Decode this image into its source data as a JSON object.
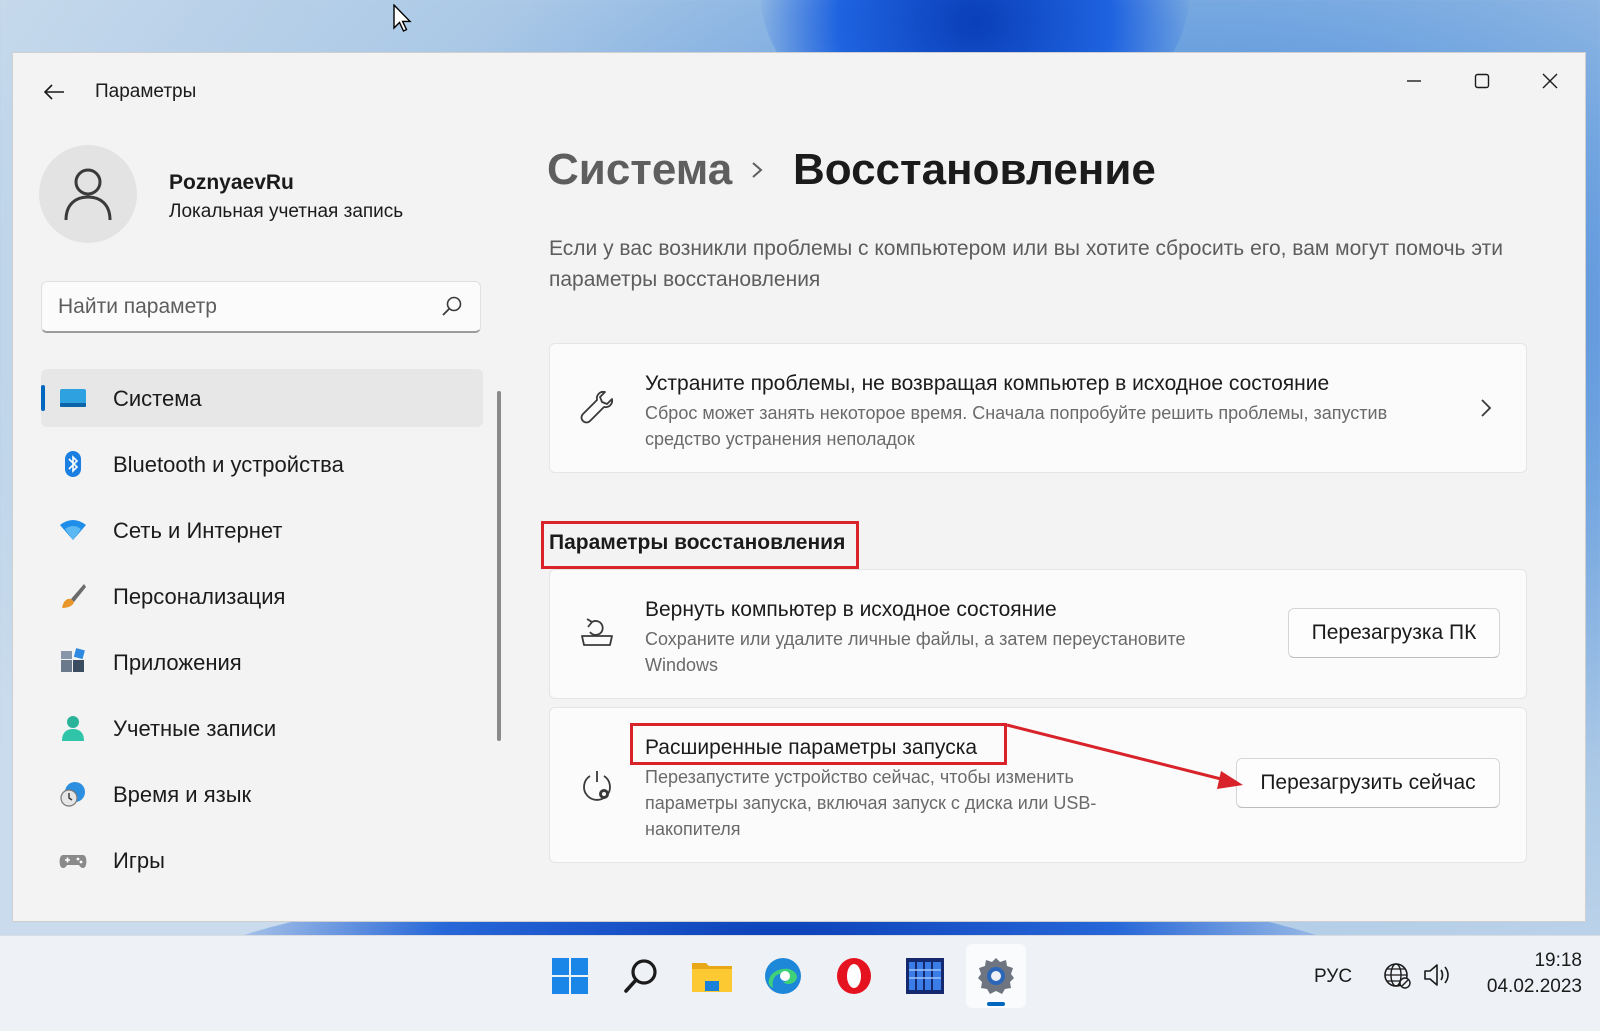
{
  "window": {
    "app_title": "Параметры"
  },
  "profile": {
    "name": "PoznyaevRu",
    "account_type": "Локальная учетная запись"
  },
  "search": {
    "placeholder": "Найти параметр"
  },
  "sidebar": {
    "items": [
      {
        "label": "Система",
        "icon": "system-icon",
        "active": true
      },
      {
        "label": "Bluetooth и устройства",
        "icon": "bluetooth-icon"
      },
      {
        "label": "Сеть и Интернет",
        "icon": "wifi-icon"
      },
      {
        "label": "Персонализация",
        "icon": "brush-icon"
      },
      {
        "label": "Приложения",
        "icon": "apps-icon"
      },
      {
        "label": "Учетные записи",
        "icon": "person-icon"
      },
      {
        "label": "Время и язык",
        "icon": "globe-clock-icon"
      },
      {
        "label": "Игры",
        "icon": "gamepad-icon"
      }
    ]
  },
  "main": {
    "breadcrumb_parent": "Система",
    "breadcrumb_current": "Восстановление",
    "description": "Если у вас возникли проблемы с компьютером или вы хотите сбросить его, вам могут помочь эти параметры восстановления",
    "troubleshoot": {
      "title": "Устраните проблемы, не возвращая компьютер в исходное состояние",
      "subtitle": "Сброс может занять некоторое время. Сначала попробуйте решить проблемы, запустив средство устранения неполадок"
    },
    "section_title": "Параметры восстановления",
    "reset": {
      "title": "Вернуть компьютер в исходное состояние",
      "subtitle": "Сохраните или удалите личные файлы, а затем переустановите Windows",
      "button": "Перезагрузка ПК"
    },
    "advanced": {
      "title": "Расширенные параметры запуска",
      "subtitle": "Перезапустите устройство сейчас, чтобы изменить параметры запуска, включая запуск с диска или USB-накопителя",
      "button": "Перезагрузить сейчас"
    }
  },
  "taskbar": {
    "apps": [
      "start-icon",
      "search-icon",
      "file-explorer-icon",
      "edge-icon",
      "opera-icon",
      "app-grid-icon",
      "settings-icon"
    ],
    "language": "РУС",
    "time": "19:18",
    "date": "04.02.2023"
  },
  "colors": {
    "accent": "#0067c0",
    "highlight_red": "#d8232a"
  }
}
